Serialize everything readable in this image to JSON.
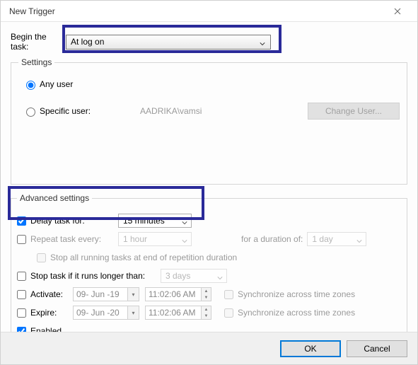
{
  "window": {
    "title": "New Trigger"
  },
  "begin": {
    "label": "Begin the task:",
    "value": "At log on"
  },
  "settings": {
    "legend": "Settings",
    "any_user": "Any user",
    "specific_user": "Specific user:",
    "specific_user_value": "AADRIKA\\vamsi",
    "change_user": "Change User..."
  },
  "advanced": {
    "legend": "Advanced settings",
    "delay_label": "Delay task for:",
    "delay_value": "15 minutes",
    "repeat_label": "Repeat task every:",
    "repeat_value": "1 hour",
    "duration_label": "for a duration of:",
    "duration_value": "1 day",
    "stop_all": "Stop all running tasks at end of repetition duration",
    "stop_if_label": "Stop task if it runs longer than:",
    "stop_if_value": "3 days",
    "activate_label": "Activate:",
    "activate_date": "09- Jun -19",
    "activate_time": "11:02:06 AM",
    "expire_label": "Expire:",
    "expire_date": "09- Jun -20",
    "expire_time": "11:02:06 AM",
    "sync": "Synchronize across time zones",
    "enabled": "Enabled"
  },
  "buttons": {
    "ok": "OK",
    "cancel": "Cancel"
  }
}
